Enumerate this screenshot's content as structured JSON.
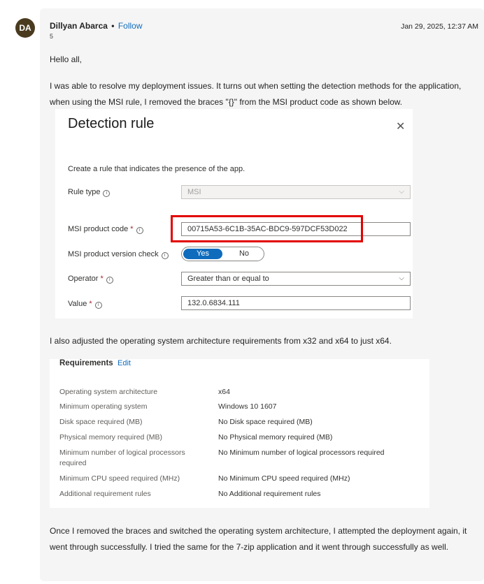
{
  "post": {
    "avatar_initials": "DA",
    "author": "Dillyan Abarca",
    "separator": "•",
    "follow": "Follow",
    "rank": "5",
    "date": "Jan 29, 2025, 12:37 AM",
    "p1": "Hello all,",
    "p2": "I was able to resolve my deployment issues. It turns out when setting the detection methods for the application, when using the MSI rule, I removed the braces \"{}\" from the MSI product code as shown below.",
    "p3": "I also adjusted the operating system architecture requirements from x32 and x64 to just x64.",
    "p4": "Once I removed the braces and switched the operating system architecture, I attempted the deployment again, it went through successfully. I tried the same for the 7-zip application and it went through successfully as well."
  },
  "detection_rule": {
    "title": "Detection rule",
    "description": "Create a rule that indicates the presence of the app.",
    "rule_type_label": "Rule type",
    "rule_type_value": "MSI",
    "product_code_label": "MSI product code",
    "product_code_value": "00715A53-6C1B-35AC-BDC9-597DCF53D022",
    "version_check_label": "MSI product version check",
    "toggle_yes": "Yes",
    "toggle_no": "No",
    "operator_label": "Operator",
    "operator_value": "Greater than or equal to",
    "value_label": "Value",
    "value_value": "132.0.6834.111",
    "required_mark": "*",
    "info_glyph": "i",
    "close_glyph": "✕",
    "chevron_glyph": "⌵"
  },
  "requirements": {
    "title": "Requirements",
    "edit": "Edit",
    "rows": [
      {
        "k": "Operating system architecture",
        "v": "x64"
      },
      {
        "k": "Minimum operating system",
        "v": "Windows 10 1607"
      },
      {
        "k": "Disk space required (MB)",
        "v": "No Disk space required (MB)"
      },
      {
        "k": "Physical memory required (MB)",
        "v": "No Physical memory required (MB)"
      },
      {
        "k": "Minimum number of logical processors required",
        "v": "No Minimum number of logical processors required"
      },
      {
        "k": "Minimum CPU speed required (MHz)",
        "v": "No Minimum CPU speed required (MHz)"
      },
      {
        "k": "Additional requirement rules",
        "v": "No Additional requirement rules"
      }
    ]
  },
  "colors": {
    "accent": "#0f6cbd",
    "highlight_box": "#e30000",
    "avatar": "#4a3b1f"
  }
}
